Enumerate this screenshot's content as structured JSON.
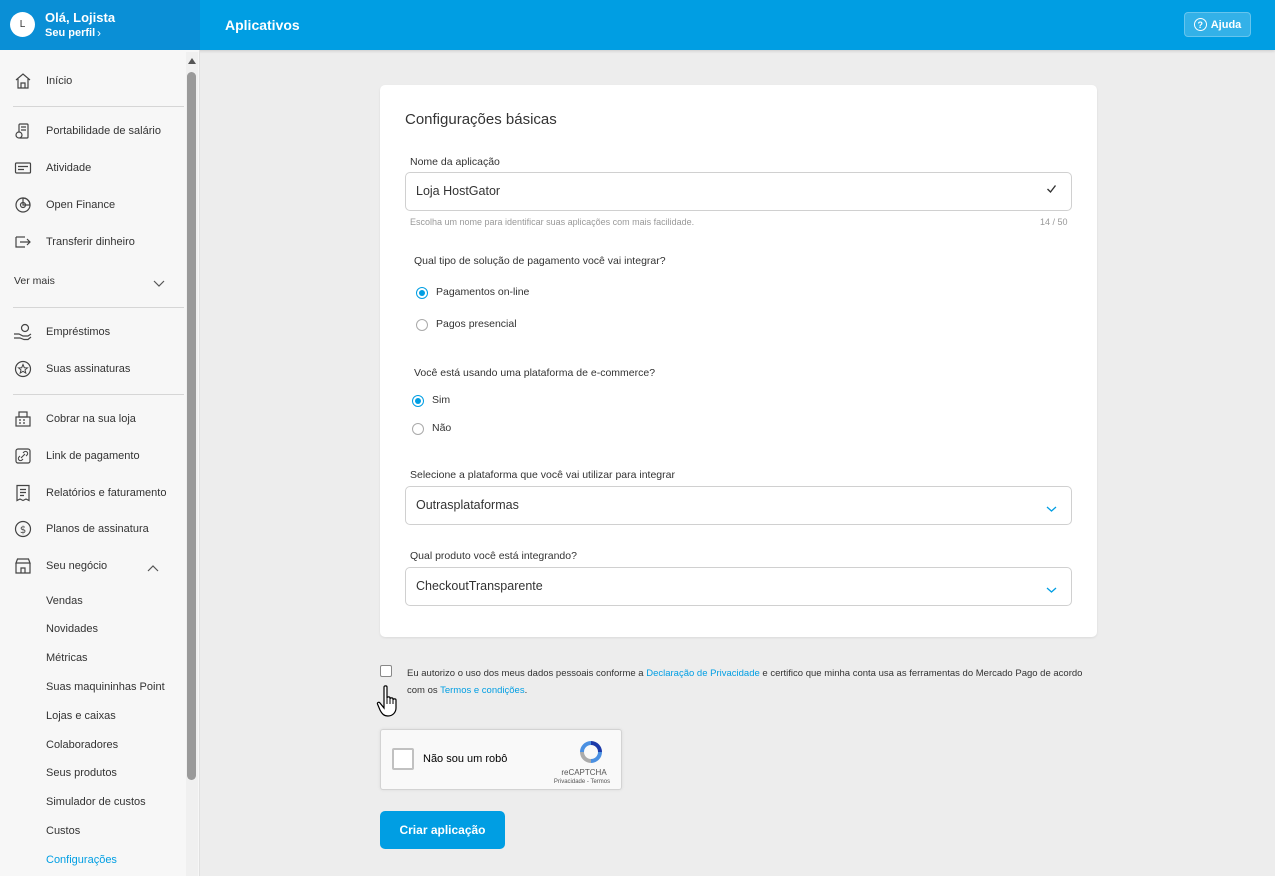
{
  "header": {
    "avatar_initial": "L",
    "greeting": "Olá, Lojista",
    "profile_link": "Seu perfil",
    "page_title": "Aplicativos",
    "help_label": "Ajuda"
  },
  "sidebar": {
    "items": [
      {
        "label": "Início",
        "icon": "home-icon"
      },
      {
        "label": "Portabilidade de salário",
        "icon": "salary-portability-icon"
      },
      {
        "label": "Atividade",
        "icon": "activity-icon"
      },
      {
        "label": "Open Finance",
        "icon": "open-finance-icon"
      },
      {
        "label": "Transferir dinheiro",
        "icon": "transfer-icon"
      }
    ],
    "see_more": "Ver mais",
    "items2": [
      {
        "label": "Empréstimos",
        "icon": "loan-icon"
      },
      {
        "label": "Suas assinaturas",
        "icon": "subscriptions-icon"
      }
    ],
    "items3": [
      {
        "label": "Cobrar na sua loja",
        "icon": "register-icon"
      },
      {
        "label": "Link de pagamento",
        "icon": "link-icon"
      },
      {
        "label": "Relatórios e faturamento",
        "icon": "report-icon"
      },
      {
        "label": "Planos de assinatura",
        "icon": "dollar-icon"
      },
      {
        "label": "Seu negócio",
        "icon": "store-icon"
      }
    ],
    "business_sub": [
      "Vendas",
      "Novidades",
      "Métricas",
      "Suas maquininhas Point",
      "Lojas e caixas",
      "Colaboradores",
      "Seus produtos",
      "Simulador de custos",
      "Custos",
      "Configurações"
    ]
  },
  "form": {
    "title": "Configurações básicas",
    "app_name_label": "Nome da aplicação",
    "app_name_value": "Loja HostGator",
    "app_name_helper": "Escolha um nome para identificar suas aplicações com mais facilidade.",
    "app_name_counter": "14 / 50",
    "payment_question": "Qual tipo de solução de pagamento você vai integrar?",
    "payment_options": [
      "Pagamentos on-line",
      "Pagos presencial"
    ],
    "payment_selected": 0,
    "ecommerce_question": "Você está usando uma plataforma de e-commerce?",
    "ecommerce_options": [
      "Sim",
      "Não"
    ],
    "ecommerce_selected": 0,
    "platform_label": "Selecione a plataforma que você vai utilizar para integrar",
    "platform_value": "Outrasplataformas",
    "product_label": "Qual produto você está integrando?",
    "product_value": "CheckoutTransparente"
  },
  "consent": {
    "text1": "Eu autorizo o uso dos meus dados pessoais conforme a ",
    "link1": "Declaração de Privacidade",
    "text2": " e certifico que minha conta usa as ferramentas do Mercado Pago de acordo com os ",
    "link2": "Termos e condições",
    "text3": "."
  },
  "recaptcha": {
    "label": "Não sou um robô",
    "brand": "reCAPTCHA",
    "terms": "Privacidade - Termos"
  },
  "create_button": "Criar aplicação",
  "colors": {
    "brand_blue": "#009ee3",
    "profile_blue": "#0a8fd6"
  }
}
